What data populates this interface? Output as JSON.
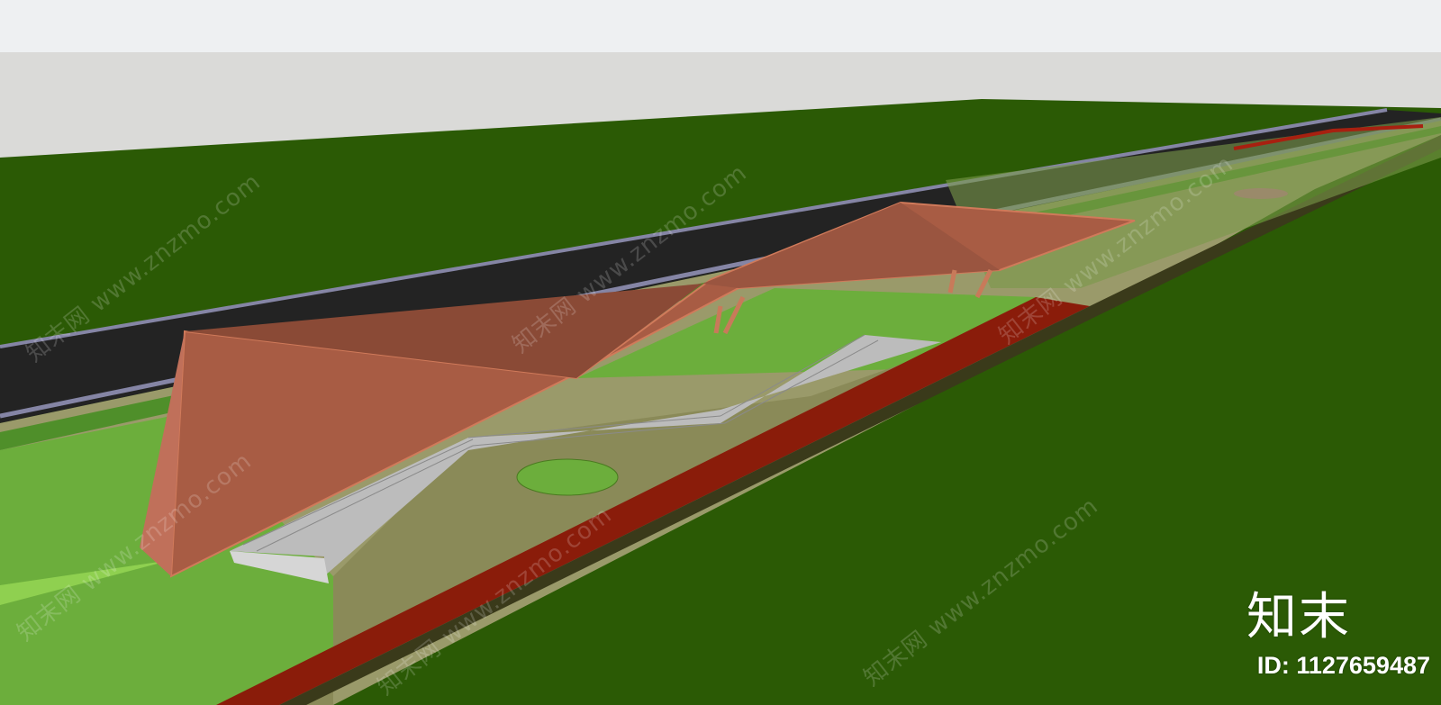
{
  "scene": {
    "description_kind": "3d-landscape-render",
    "colors": {
      "sky": "#eceef0",
      "horizon": "#dcdcdc",
      "ground": "#2b5a05",
      "road": "#222222",
      "road_edge": "#7a7a9a",
      "lawn": "#6fae3f",
      "plaza": "#8a8a5a",
      "track": "#8b1a0a",
      "canopy": "#b5674d",
      "canopy_dark": "#8e4f3c",
      "steps": "#b8b8b8"
    }
  },
  "watermark": {
    "diagonal_text": "知末网 www.znzmo.com",
    "brand": "知末",
    "id_text": "ID: 1127659487"
  }
}
